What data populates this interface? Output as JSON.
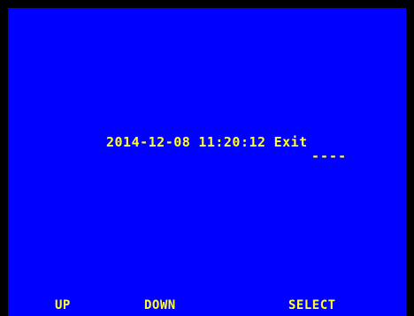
{
  "osd": {
    "date": "2014-12-08",
    "time": "11:20:12",
    "exit_label": "Exit",
    "cursor": "----"
  },
  "softkeys": {
    "up": "UP",
    "down": "DOWN",
    "select": "SELECT"
  },
  "colors": {
    "background": "#0000FF",
    "text": "#FFFF33",
    "border": "#000000"
  }
}
